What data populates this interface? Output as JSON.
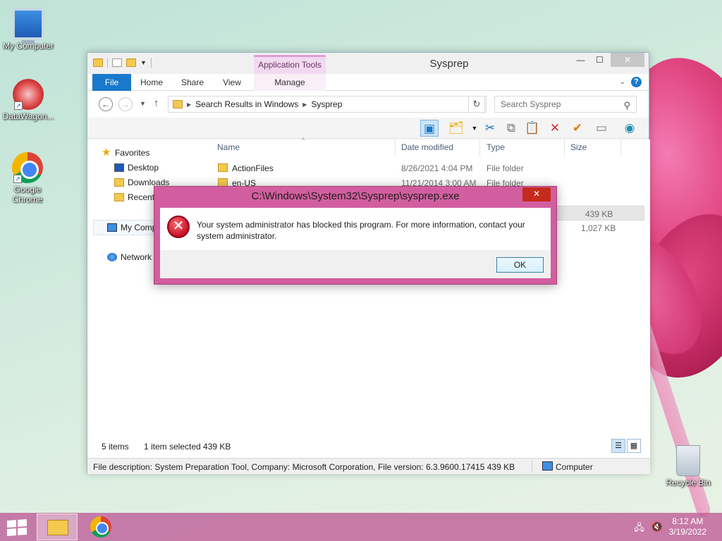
{
  "desktop": {
    "icons": [
      {
        "label": "My Computer"
      },
      {
        "label": "DataWagon..."
      },
      {
        "label": "Google Chrome"
      },
      {
        "label": "Recycle Bin"
      }
    ]
  },
  "explorer": {
    "title": "Sysprep",
    "app_tools_label": "Application Tools",
    "ribbon_tabs": {
      "file": "File",
      "home": "Home",
      "share": "Share",
      "view": "View",
      "manage": "Manage"
    },
    "breadcrumb": [
      "Search Results in Windows",
      "Sysprep"
    ],
    "search_placeholder": "Search Sysprep",
    "nav": {
      "favorites": "Favorites",
      "desktop": "Desktop",
      "downloads": "Downloads",
      "recent": "Recent places",
      "my_computer": "My Computer",
      "network": "Network"
    },
    "columns": {
      "name": "Name",
      "date": "Date modified",
      "type": "Type",
      "size": "Size"
    },
    "rows": [
      {
        "name": "ActionFiles",
        "date": "8/26/2021 4:04 PM",
        "type": "File folder",
        "size": ""
      },
      {
        "name": "en-US",
        "date": "11/21/2014 3:00 AM",
        "type": "File folder",
        "size": ""
      },
      {
        "name": "",
        "date": "",
        "type": "",
        "size": "439 KB"
      },
      {
        "name": "",
        "date": "",
        "type": "",
        "size": "1,027 KB"
      }
    ],
    "status": {
      "items": "5 items",
      "selected": "1 item selected  439 KB"
    },
    "description": "File description: System Preparation Tool, Company: Microsoft Corporation, File version: 6.3.9600.17415 439 KB",
    "location": "Computer"
  },
  "dialog": {
    "title": "C:\\Windows\\System32\\Sysprep\\sysprep.exe",
    "message": "Your system administrator has blocked this program. For more information, contact your system administrator.",
    "ok": "OK"
  },
  "taskbar": {
    "time": "8:12 AM",
    "date": "3/19/2022"
  }
}
